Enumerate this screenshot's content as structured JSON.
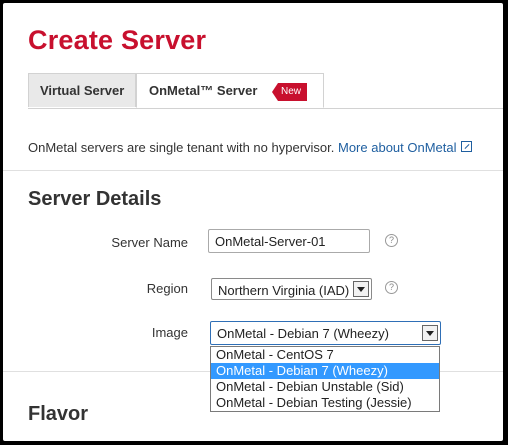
{
  "page": {
    "title": "Create Server"
  },
  "tabs": [
    {
      "label": "Virtual Server"
    },
    {
      "label": "OnMetal™ Server",
      "badge": "New"
    }
  ],
  "description": {
    "text": "OnMetal servers are single tenant with no hypervisor.",
    "link": "More about OnMetal"
  },
  "server_details": {
    "heading": "Server Details",
    "name_label": "Server Name",
    "name_value": "OnMetal-Server-01",
    "region_label": "Region",
    "region_value": "Northern Virginia (IAD)",
    "image_label": "Image",
    "image_value": "OnMetal - Debian 7 (Wheezy)",
    "image_options": [
      "OnMetal - CentOS 7",
      "OnMetal - Debian 7 (Wheezy)",
      "OnMetal - Debian Unstable (Sid)",
      "OnMetal - Debian Testing (Jessie)"
    ],
    "selected_option_index": 1
  },
  "flavor": {
    "heading": "Flavor"
  },
  "colors": {
    "brand_red": "#c8102e",
    "link_blue": "#1f5fa0",
    "selection_blue": "#3399ff"
  },
  "icons": {
    "help": "question-icon",
    "external": "external-link-icon",
    "dropdown": "chevron-down-icon"
  }
}
